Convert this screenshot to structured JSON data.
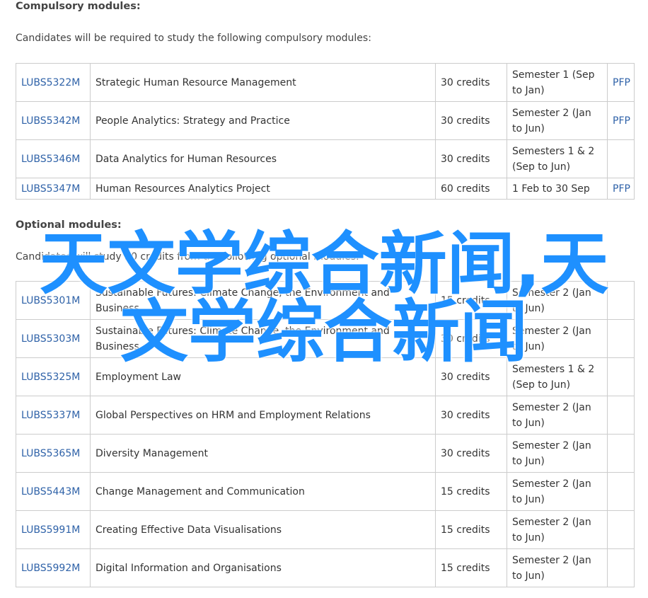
{
  "compulsory": {
    "heading": "Compulsory modules:",
    "intro": "Candidates will be required to study the following compulsory modules:",
    "rows": [
      {
        "code": "LUBS5322M",
        "title": "Strategic Human Resource Management",
        "credits": "30 credits",
        "semester": "Semester 1 (Sep to Jan)",
        "pfp": "PFP"
      },
      {
        "code": "LUBS5342M",
        "title": "People Analytics: Strategy and Practice",
        "credits": "30 credits",
        "semester": "Semester 2 (Jan to Jun)",
        "pfp": "PFP"
      },
      {
        "code": "LUBS5346M",
        "title": "Data Analytics for Human Resources",
        "credits": "30 credits",
        "semester": "Semesters 1 & 2 (Sep to Jun)",
        "pfp": ""
      },
      {
        "code": "LUBS5347M",
        "title": "Human Resources Analytics Project",
        "credits": "60 credits",
        "semester": "1 Feb to 30 Sep",
        "pfp": "PFP"
      }
    ]
  },
  "optional": {
    "heading": "Optional modules:",
    "intro": "Candidates will study 30 credits from the following optional modules:",
    "rows": [
      {
        "code": "LUBS5301M",
        "title": "Sustainable Futures: Climate Change, the Environment and Business",
        "credits": "15 credits",
        "semester": "Semester 2 (Jan to Jun)",
        "pfp": ""
      },
      {
        "code": "LUBS5303M",
        "title": "Sustainable Futures: Climate Change, the Environment and Business",
        "credits": "30 credits",
        "semester": "Semester 2 (Jan to Jun)",
        "pfp": ""
      },
      {
        "code": "LUBS5325M",
        "title": "Employment Law",
        "credits": "30 credits",
        "semester": "Semesters 1 & 2 (Sep to Jun)",
        "pfp": ""
      },
      {
        "code": "LUBS5337M",
        "title": "Global Perspectives on HRM and Employment Relations",
        "credits": "30 credits",
        "semester": "Semester 2 (Jan to Jun)",
        "pfp": ""
      },
      {
        "code": "LUBS5365M",
        "title": "Diversity Management",
        "credits": "30 credits",
        "semester": "Semester 2 (Jan to Jun)",
        "pfp": ""
      },
      {
        "code": "LUBS5443M",
        "title": "Change Management and Communication",
        "credits": "15 credits",
        "semester": "Semester 2 (Jan to Jun)",
        "pfp": ""
      },
      {
        "code": "LUBS5991M",
        "title": "Creating Effective Data Visualisations",
        "credits": "15 credits",
        "semester": "Semester 2 (Jan to Jun)",
        "pfp": ""
      },
      {
        "code": "LUBS5992M",
        "title": "Digital Information and Organisations",
        "credits": "15 credits",
        "semester": "Semester 2 (Jan to Jun)",
        "pfp": ""
      }
    ]
  },
  "watermark": {
    "text": "天文学综合新闻,天文学综合新闻",
    "color": "#1e90ff"
  },
  "colors": {
    "link": "#2f62a8",
    "border": "#cccccc",
    "text": "#333333"
  }
}
